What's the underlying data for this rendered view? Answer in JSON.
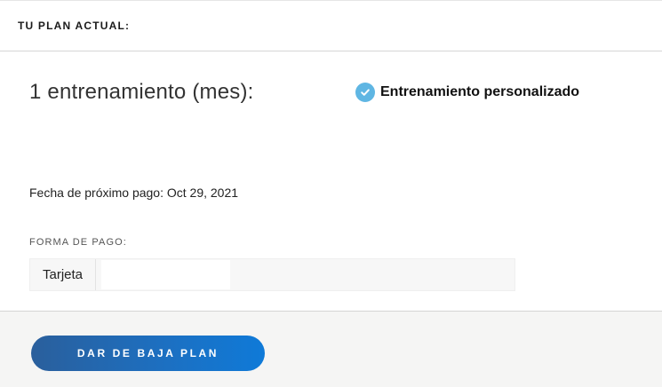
{
  "header": {
    "title": "TU PLAN ACTUAL:"
  },
  "plan": {
    "name": "1 entrenamiento (mes):",
    "features": [
      {
        "label": "Entrenamiento personalizado",
        "icon": "check-circle-icon",
        "icon_color": "#5fb6e3"
      }
    ]
  },
  "billing": {
    "next_payment": "Fecha de próximo pago: Oct 29, 2021",
    "payment_label": "FORMA DE PAGO:",
    "payment_method": "Tarjeta",
    "payment_value": ""
  },
  "footer": {
    "cancel_button_label": "DAR DE BAJA PLAN",
    "button_gradient": [
      "#2a5f9c",
      "#0f7ad8"
    ]
  }
}
